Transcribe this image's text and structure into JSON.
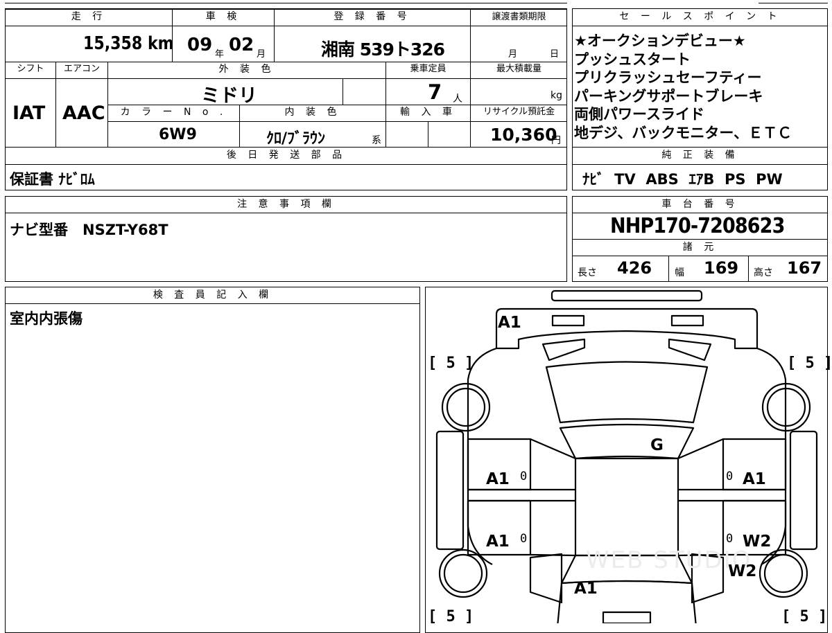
{
  "table": {
    "headers": {
      "mileage": "走 行",
      "inspection": "車 検",
      "registration": "登 録 番 号",
      "transfer_deadline": "譲渡書類期限",
      "shift": "シフト",
      "aircon": "エアコン",
      "exterior_color": "外 装 色",
      "capacity": "乗車定員",
      "max_load": "最大積載量",
      "color_no": "カ ラ ー N o .",
      "interior_color": "内 装 色",
      "import": "輸 入 車",
      "recycle": "リサイクル預託金",
      "later_parts": "後 日 発 送 部 品",
      "notes": "注 意 事 項 欄",
      "inspector": "検 査 員 記 入 欄"
    },
    "mileage": "15,358 km",
    "inspection_year": "09",
    "inspection_year_unit": "年",
    "inspection_month": "02",
    "inspection_month_unit": "月",
    "registration": "湘南 539ト326",
    "transfer_month_unit": "月",
    "transfer_day_unit": "日",
    "shift": "IAT",
    "aircon": "AAC",
    "exterior_color": "ミドリ",
    "capacity": "7",
    "capacity_unit": "人",
    "max_load_unit": "kg",
    "color_no": "6W9",
    "interior_color": "ｸﾛ/ﾌﾞﾗｳﾝ",
    "interior_suffix": "系",
    "recycle": "10,360",
    "recycle_unit": "円",
    "later_parts": "保証書 ﾅﾋﾞﾛﾑ",
    "notes": "ナビ型番　NSZT-Y68T",
    "inspector_note": "室内内張傷"
  },
  "sales": {
    "header": "セ ー ル ス ポ イ ン ト",
    "lines": [
      "★オークションデビュー★",
      "プッシュスタート",
      "プリクラッシュセーフティー",
      "パーキングサポートブレーキ",
      "両側パワースライド",
      "地デジ、バックモニター、ＥＴＣ"
    ]
  },
  "equipment": {
    "header": "純 正 装 備",
    "value": "ﾅﾋﾞ  TV  ABS  ｴｱB  PS  PW"
  },
  "chassis": {
    "header": "車 台 番 号",
    "value": "NHP170-7208623"
  },
  "specs": {
    "header": "諸 元",
    "length_label": "長さ",
    "length": "426",
    "width_label": "幅",
    "width": "169",
    "height_label": "高さ",
    "height": "167"
  },
  "diagram": {
    "marks": {
      "front": "A1",
      "hood": "G",
      "left_front_door": "A1",
      "right_front_door": "A1",
      "left_rear_door": "A1",
      "right_rear_door": "W2",
      "right_rear_fender": "W2",
      "rear": "A1"
    },
    "tire_marks": [
      "[ 5 ]",
      "[ 5 ]",
      "[ 5 ]",
      "[ 5 ]"
    ],
    "zeros": [
      "0",
      "0",
      "0",
      "0"
    ],
    "watermark": "WEB STUDIO"
  }
}
